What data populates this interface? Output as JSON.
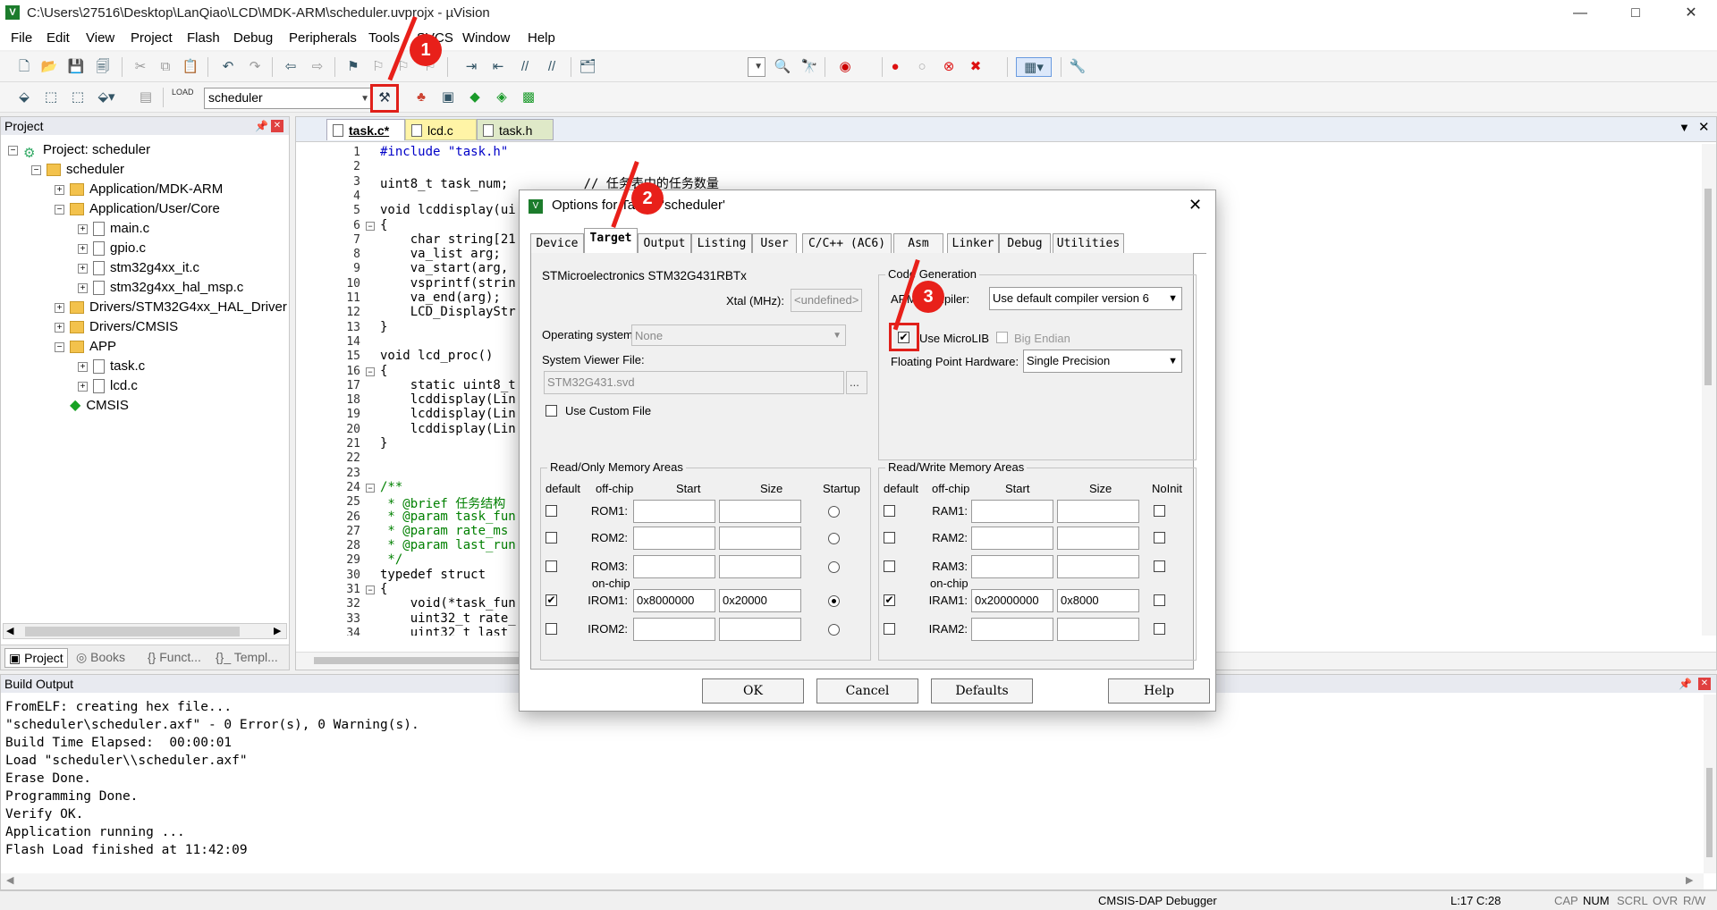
{
  "window": {
    "title": "C:\\Users\\27516\\Desktop\\LanQiao\\LCD\\MDK-ARM\\scheduler.uvprojx - µVision",
    "controls": {
      "minimize": "—",
      "maximize": "□",
      "close": "✕"
    }
  },
  "menu": [
    "File",
    "Edit",
    "View",
    "Project",
    "Flash",
    "Debug",
    "Peripherals",
    "Tools",
    "SVCS",
    "Window",
    "Help"
  ],
  "toolbar2": {
    "target_combo": "scheduler",
    "load_label": "LOAD"
  },
  "annotations": [
    "1",
    "2",
    "3"
  ],
  "project_panel": {
    "title": "Project",
    "tree": [
      {
        "label": "Project: scheduler",
        "level": 0,
        "type": "project",
        "exp": "−"
      },
      {
        "label": "scheduler",
        "level": 1,
        "type": "target",
        "exp": "−"
      },
      {
        "label": "Application/MDK-ARM",
        "level": 2,
        "type": "folder",
        "exp": "+"
      },
      {
        "label": "Application/User/Core",
        "level": 2,
        "type": "folder",
        "exp": "−"
      },
      {
        "label": "main.c",
        "level": 3,
        "type": "file",
        "exp": "+"
      },
      {
        "label": "gpio.c",
        "level": 3,
        "type": "file",
        "exp": "+"
      },
      {
        "label": "stm32g4xx_it.c",
        "level": 3,
        "type": "file",
        "exp": "+"
      },
      {
        "label": "stm32g4xx_hal_msp.c",
        "level": 3,
        "type": "file",
        "exp": "+"
      },
      {
        "label": "Drivers/STM32G4xx_HAL_Driver",
        "level": 2,
        "type": "folder",
        "exp": "+"
      },
      {
        "label": "Drivers/CMSIS",
        "level": 2,
        "type": "folder",
        "exp": "+"
      },
      {
        "label": "APP",
        "level": 2,
        "type": "folder",
        "exp": "−"
      },
      {
        "label": "task.c",
        "level": 3,
        "type": "file",
        "exp": "+"
      },
      {
        "label": "lcd.c",
        "level": 3,
        "type": "file",
        "exp": "+"
      },
      {
        "label": "CMSIS",
        "level": 2,
        "type": "cmsis",
        "exp": ""
      }
    ],
    "bottom_tabs": [
      "Project",
      "Books",
      "{} Funct...",
      "{}_ Templ..."
    ]
  },
  "editor": {
    "tabs": [
      "task.c*",
      "lcd.c",
      "task.h"
    ],
    "lines": [
      {
        "n": "1",
        "t": "#include \"task.h\""
      },
      {
        "n": "2",
        "t": ""
      },
      {
        "n": "3",
        "t": "uint8_t task_num;          // 任务表中的任务数量"
      },
      {
        "n": "4",
        "t": ""
      },
      {
        "n": "5",
        "t": "void lcddisplay(ui"
      },
      {
        "n": "6",
        "t": "{"
      },
      {
        "n": "7",
        "t": "    char string[21"
      },
      {
        "n": "8",
        "t": "    va_list arg;"
      },
      {
        "n": "9",
        "t": "    va_start(arg,"
      },
      {
        "n": "10",
        "t": "    vsprintf(strin"
      },
      {
        "n": "11",
        "t": "    va_end(arg);"
      },
      {
        "n": "12",
        "t": "    LCD_DisplayStr"
      },
      {
        "n": "13",
        "t": "}"
      },
      {
        "n": "14",
        "t": ""
      },
      {
        "n": "15",
        "t": "void lcd_proc()"
      },
      {
        "n": "16",
        "t": "{"
      },
      {
        "n": "17",
        "t": "    static uint8_t"
      },
      {
        "n": "18",
        "t": "    lcddisplay(Lin"
      },
      {
        "n": "19",
        "t": "    lcddisplay(Lin"
      },
      {
        "n": "20",
        "t": "    lcddisplay(Lin"
      },
      {
        "n": "21",
        "t": "}"
      },
      {
        "n": "22",
        "t": ""
      },
      {
        "n": "23",
        "t": ""
      },
      {
        "n": "24",
        "t": "/**"
      },
      {
        "n": "25",
        "t": " * @brief 任务结构"
      },
      {
        "n": "26",
        "t": " * @param task_fun"
      },
      {
        "n": "27",
        "t": " * @param rate_ms"
      },
      {
        "n": "28",
        "t": " * @param last_run"
      },
      {
        "n": "29",
        "t": " */"
      },
      {
        "n": "30",
        "t": "typedef struct"
      },
      {
        "n": "31",
        "t": "{"
      },
      {
        "n": "32",
        "t": "    void(*task_fun"
      },
      {
        "n": "33",
        "t": "    uint32_t rate_"
      },
      {
        "n": "34",
        "t": "    uint32_t last_"
      },
      {
        "n": "35",
        "t": "} task_t;"
      }
    ]
  },
  "dialog": {
    "title": "Options for Target 'scheduler'",
    "close": "✕",
    "tabs": [
      "Device",
      "Target",
      "Output",
      "Listing",
      "User",
      "C/C++ (AC6)",
      "Asm",
      "Linker",
      "Debug",
      "Utilities"
    ],
    "device_name": "STMicroelectronics STM32G431RBTx",
    "xtal_label": "Xtal (MHz):",
    "xtal_value": "<undefined>",
    "os_label": "Operating system:",
    "os_value": "None",
    "svd_label": "System Viewer File:",
    "svd_value": "STM32G431.svd",
    "svd_browse": "...",
    "use_custom_file": "Use Custom File",
    "codegen": {
      "title": "Code Generation",
      "compiler_label": "ARM Compiler:",
      "compiler_value": "Use default compiler version 6",
      "microlib": "Use MicroLIB",
      "big_endian": "Big Endian",
      "fph_label": "Floating Point Hardware:",
      "fph_value": "Single Precision"
    },
    "ro_mem": {
      "title": "Read/Only Memory Areas",
      "headers": [
        "default",
        "off-chip",
        "Start",
        "Size",
        "Startup"
      ],
      "onchip": "on-chip",
      "rows": [
        {
          "name": "ROM1:",
          "start": "",
          "size": "",
          "default": false,
          "startup": false
        },
        {
          "name": "ROM2:",
          "start": "",
          "size": "",
          "default": false,
          "startup": false
        },
        {
          "name": "ROM3:",
          "start": "",
          "size": "",
          "default": false,
          "startup": false
        },
        {
          "name": "IROM1:",
          "start": "0x8000000",
          "size": "0x20000",
          "default": true,
          "startup": true
        },
        {
          "name": "IROM2:",
          "start": "",
          "size": "",
          "default": false,
          "startup": false
        }
      ]
    },
    "rw_mem": {
      "title": "Read/Write Memory Areas",
      "headers": [
        "default",
        "off-chip",
        "Start",
        "Size",
        "NoInit"
      ],
      "onchip": "on-chip",
      "rows": [
        {
          "name": "RAM1:",
          "start": "",
          "size": "",
          "default": false
        },
        {
          "name": "RAM2:",
          "start": "",
          "size": "",
          "default": false
        },
        {
          "name": "RAM3:",
          "start": "",
          "size": "",
          "default": false
        },
        {
          "name": "IRAM1:",
          "start": "0x20000000",
          "size": "0x8000",
          "default": true
        },
        {
          "name": "IRAM2:",
          "start": "",
          "size": "",
          "default": false
        }
      ]
    },
    "buttons": [
      "OK",
      "Cancel",
      "Defaults",
      "Help"
    ]
  },
  "build_output": {
    "title": "Build Output",
    "lines": [
      "FromELF: creating hex file...",
      "\"scheduler\\scheduler.axf\" - 0 Error(s), 0 Warning(s).",
      "Build Time Elapsed:  00:00:01",
      "Load \"scheduler\\\\scheduler.axf\"",
      "Erase Done.",
      "Programming Done.",
      "Verify OK.",
      "Application running ...",
      "Flash Load finished at 11:42:09"
    ]
  },
  "status": {
    "debugger": "CMSIS-DAP Debugger",
    "pos": "L:17 C:28",
    "cap": "CAP",
    "num": "NUM",
    "scrl": "SCRL",
    "ovr": "OVR",
    "rw": "R/W"
  }
}
